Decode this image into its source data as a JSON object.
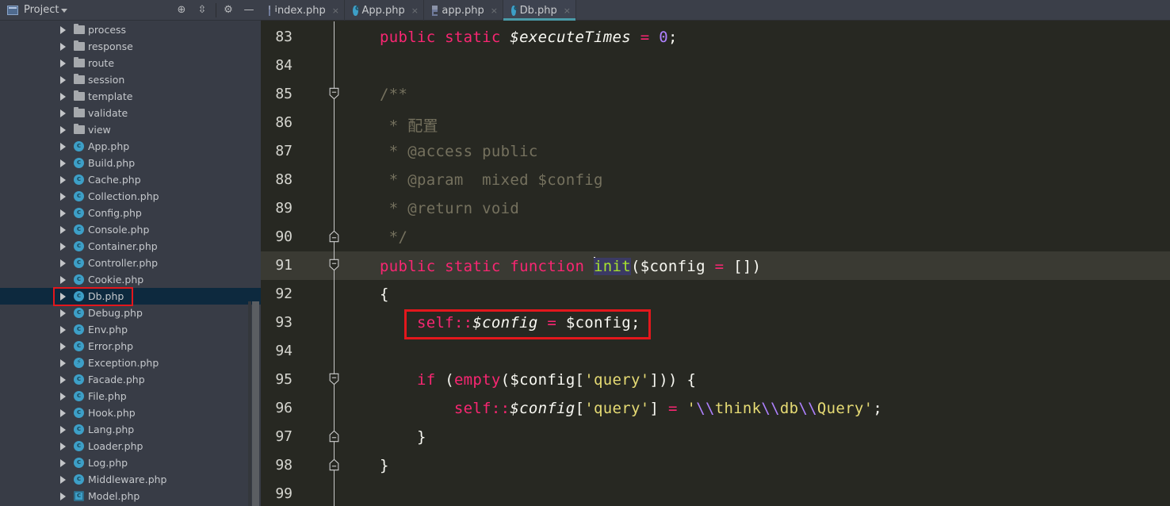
{
  "sidebar": {
    "title": "Project",
    "header_buttons": [
      "locate-icon",
      "collapse-icon",
      "gear-icon",
      "hide-icon"
    ],
    "items": [
      {
        "label": "process",
        "type": "folder"
      },
      {
        "label": "response",
        "type": "folder"
      },
      {
        "label": "route",
        "type": "folder"
      },
      {
        "label": "session",
        "type": "folder"
      },
      {
        "label": "template",
        "type": "folder"
      },
      {
        "label": "validate",
        "type": "folder"
      },
      {
        "label": "view",
        "type": "folder"
      },
      {
        "label": "App.php",
        "type": "class"
      },
      {
        "label": "Build.php",
        "type": "class"
      },
      {
        "label": "Cache.php",
        "type": "class"
      },
      {
        "label": "Collection.php",
        "type": "class"
      },
      {
        "label": "Config.php",
        "type": "class"
      },
      {
        "label": "Console.php",
        "type": "class"
      },
      {
        "label": "Container.php",
        "type": "class"
      },
      {
        "label": "Controller.php",
        "type": "class"
      },
      {
        "label": "Cookie.php",
        "type": "class"
      },
      {
        "label": "Db.php",
        "type": "class",
        "selected": true
      },
      {
        "label": "Debug.php",
        "type": "class"
      },
      {
        "label": "Env.php",
        "type": "class"
      },
      {
        "label": "Error.php",
        "type": "class"
      },
      {
        "label": "Exception.php",
        "type": "exception"
      },
      {
        "label": "Facade.php",
        "type": "class"
      },
      {
        "label": "File.php",
        "type": "class"
      },
      {
        "label": "Hook.php",
        "type": "class"
      },
      {
        "label": "Lang.php",
        "type": "class"
      },
      {
        "label": "Loader.php",
        "type": "class"
      },
      {
        "label": "Log.php",
        "type": "class"
      },
      {
        "label": "Middleware.php",
        "type": "class"
      },
      {
        "label": "Model.php",
        "type": "model"
      }
    ]
  },
  "tabs": [
    {
      "label": "index.php",
      "icon": "php-file-icon",
      "active": false
    },
    {
      "label": "App.php",
      "icon": "php-class-icon",
      "active": false
    },
    {
      "label": "app.php",
      "icon": "php-file-icon",
      "active": false
    },
    {
      "label": "Db.php",
      "icon": "php-class-icon",
      "active": true
    }
  ],
  "tab_close_glyph": "×",
  "editor": {
    "current_line": 91,
    "highlighted_line": 93,
    "lines": [
      {
        "n": "83",
        "tokens": [
          [
            "kw",
            "public static "
          ],
          [
            "var-it",
            "$executeTimes"
          ],
          [
            "op",
            " = "
          ],
          [
            "num",
            "0"
          ],
          [
            "",
            "; "
          ]
        ]
      },
      {
        "n": "84",
        "tokens": []
      },
      {
        "n": "85",
        "tokens": [
          [
            "cmt",
            "/**"
          ]
        ],
        "fold": "start"
      },
      {
        "n": "86",
        "tokens": [
          [
            "cmt",
            " * 配置"
          ]
        ]
      },
      {
        "n": "87",
        "tokens": [
          [
            "cmt",
            " * @access public"
          ]
        ]
      },
      {
        "n": "88",
        "tokens": [
          [
            "cmt",
            " * @param  mixed $config"
          ]
        ]
      },
      {
        "n": "89",
        "tokens": [
          [
            "cmt",
            " * @return void"
          ]
        ]
      },
      {
        "n": "90",
        "tokens": [
          [
            "cmt",
            " */"
          ]
        ],
        "fold": "end"
      },
      {
        "n": "91",
        "tokens": [
          [
            "kw",
            "public static function "
          ],
          [
            "caret",
            ""
          ],
          [
            "fn",
            "init"
          ],
          [
            "",
            "($config "
          ],
          [
            "op",
            "="
          ],
          [
            "",
            " [])"
          ]
        ],
        "fold": "start"
      },
      {
        "n": "92",
        "tokens": [
          [
            "",
            "{"
          ]
        ]
      },
      {
        "n": "93",
        "tokens": [
          [
            "",
            "    "
          ],
          [
            "kw",
            "self"
          ],
          [
            "op",
            "::"
          ],
          [
            "var-it",
            "$config"
          ],
          [
            "op",
            " = "
          ],
          [
            "",
            "$config;"
          ]
        ]
      },
      {
        "n": "94",
        "tokens": []
      },
      {
        "n": "95",
        "tokens": [
          [
            "",
            "    "
          ],
          [
            "kw",
            "if"
          ],
          [
            "",
            " ("
          ],
          [
            "kw",
            "empty"
          ],
          [
            "",
            "($config["
          ],
          [
            "str",
            "'query'"
          ],
          [
            "",
            "])) {"
          ]
        ],
        "fold": "start"
      },
      {
        "n": "96",
        "tokens": [
          [
            "",
            "        "
          ],
          [
            "kw",
            "self"
          ],
          [
            "op",
            "::"
          ],
          [
            "var-it",
            "$config"
          ],
          [
            "",
            "["
          ],
          [
            "str",
            "'query'"
          ],
          [
            "",
            "] "
          ],
          [
            "op",
            "="
          ],
          [
            "",
            " "
          ],
          [
            "str",
            "'"
          ],
          [
            "esc",
            "\\\\"
          ],
          [
            "str",
            "think"
          ],
          [
            "esc",
            "\\\\"
          ],
          [
            "str",
            "db"
          ],
          [
            "esc",
            "\\\\"
          ],
          [
            "str",
            "Query'"
          ],
          [
            "",
            ";"
          ]
        ]
      },
      {
        "n": "97",
        "tokens": [
          [
            "",
            "    }"
          ]
        ],
        "fold": "end"
      },
      {
        "n": "98",
        "tokens": [
          [
            "",
            "}"
          ]
        ],
        "fold": "end"
      },
      {
        "n": "99",
        "tokens": []
      }
    ]
  }
}
